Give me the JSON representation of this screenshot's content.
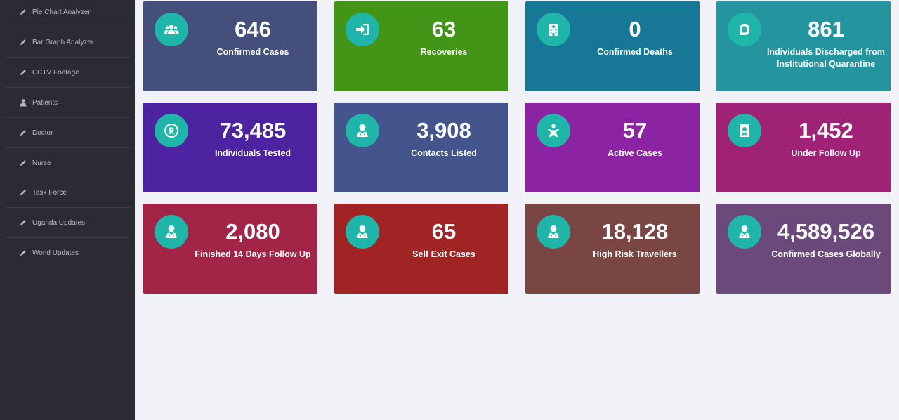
{
  "sidebar": {
    "items": [
      {
        "label": "Pie Chart Analyzer",
        "icon": "pencil-icon"
      },
      {
        "label": "Bar Graph Analyzer",
        "icon": "pencil-icon"
      },
      {
        "label": "CCTV Footage",
        "icon": "pencil-icon"
      },
      {
        "label": "Patients",
        "icon": "user-icon"
      },
      {
        "label": "Doctor",
        "icon": "pencil-icon"
      },
      {
        "label": "Nurse",
        "icon": "pencil-icon"
      },
      {
        "label": "Task Force",
        "icon": "pencil-icon"
      },
      {
        "label": "Uganda Updates",
        "icon": "pencil-icon"
      },
      {
        "label": "World Updates",
        "icon": "pencil-icon"
      }
    ]
  },
  "cards": [
    {
      "value": "646",
      "label": "Confirmed Cases",
      "color": "#44507b",
      "icon": "users-icon"
    },
    {
      "value": "63",
      "label": "Recoveries",
      "color": "#429516",
      "icon": "sign-in-icon"
    },
    {
      "value": "0",
      "label": "Confirmed Deaths",
      "color": "#167896",
      "icon": "hospital-icon"
    },
    {
      "value": "861",
      "label": "Individuals Discharged from Institutional Quarantine",
      "color": "#24959e",
      "icon": "discharge-icon"
    },
    {
      "value": "73,485",
      "label": "Individuals Tested",
      "color": "#4d23a1",
      "icon": "registered-icon"
    },
    {
      "value": "3,908",
      "label": "Contacts Listed",
      "color": "#44548d",
      "icon": "user-doctor-icon"
    },
    {
      "value": "57",
      "label": "Active Cases",
      "color": "#8c23a3",
      "icon": "baby-icon"
    },
    {
      "value": "1,452",
      "label": "Under Follow Up",
      "color": "#a02277",
      "icon": "file-medical-icon"
    },
    {
      "value": "2,080",
      "label": "Finished 14 Days Follow Up",
      "color": "#a22446",
      "icon": "user-doctor-icon"
    },
    {
      "value": "65",
      "label": "Self Exit Cases",
      "color": "#a02424",
      "icon": "user-doctor-icon"
    },
    {
      "value": "18,128",
      "label": "High Risk Travellers",
      "color": "#7a4644",
      "icon": "user-doctor-icon"
    },
    {
      "value": "4,589,526",
      "label": "Confirmed Cases Globally",
      "color": "#6b4a7b",
      "icon": "user-doctor-icon"
    }
  ]
}
